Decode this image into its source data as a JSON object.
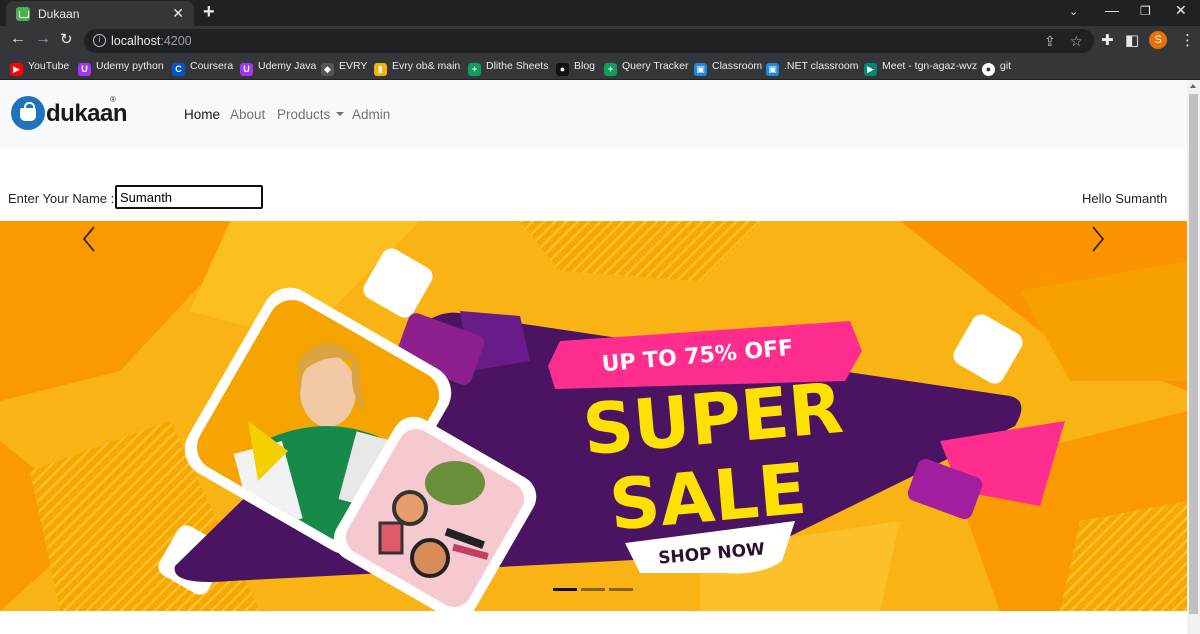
{
  "browser": {
    "tab_title": "Dukaan",
    "url_host": "localhost",
    "url_port": ":4200",
    "profile_initial": "S",
    "bookmarks": [
      {
        "label": "YouTube",
        "icon": "youtube-icon",
        "color": "#ff0000"
      },
      {
        "label": "Udemy python",
        "icon": "udemy-icon",
        "color": "#a435f0"
      },
      {
        "label": "Coursera",
        "icon": "coursera-icon",
        "color": "#0056d2"
      },
      {
        "label": "Udemy Java",
        "icon": "udemy-icon",
        "color": "#a435f0"
      },
      {
        "label": "EVRY",
        "icon": "evry-icon",
        "color": "#555555"
      },
      {
        "label": "Evry ob& main",
        "icon": "docs-icon",
        "color": "#f4b400"
      },
      {
        "label": "Dlithe Sheets",
        "icon": "sheets-icon",
        "color": "#0f9d58"
      },
      {
        "label": "Blog",
        "icon": "medium-icon",
        "color": "#111111"
      },
      {
        "label": "Query Tracker",
        "icon": "sheets-icon",
        "color": "#0f9d58"
      },
      {
        "label": "Classroom",
        "icon": "classroom-icon",
        "color": "#1e88e5"
      },
      {
        "label": ".NET classroom",
        "icon": "classroom-icon",
        "color": "#1e88e5"
      },
      {
        "label": "Meet - tgn-agaz-wvz",
        "icon": "meet-icon",
        "color": "#00897b"
      },
      {
        "label": "git",
        "icon": "github-icon",
        "color": "#ffffff"
      }
    ]
  },
  "navbar": {
    "brand": "dukaan",
    "brand_mark": "®",
    "links": [
      {
        "label": "Home",
        "active": true
      },
      {
        "label": "About",
        "active": false
      },
      {
        "label": "Products",
        "active": false,
        "dropdown": true
      },
      {
        "label": "Admin",
        "active": false
      }
    ]
  },
  "form": {
    "label": "Enter Your Name :",
    "value": "Sumanth",
    "greeting": "Hello Sumanth"
  },
  "carousel": {
    "banner_top": "UP TO 75% OFF",
    "banner_line1": "SUPER",
    "banner_line2": "SALE",
    "banner_cta": "SHOP NOW",
    "slide_count": 3,
    "active_slide": 1,
    "colors": {
      "background": "#f9b314",
      "purple": "#4a1462",
      "pink": "#ff2d8d",
      "headline": "#ffe100"
    }
  }
}
